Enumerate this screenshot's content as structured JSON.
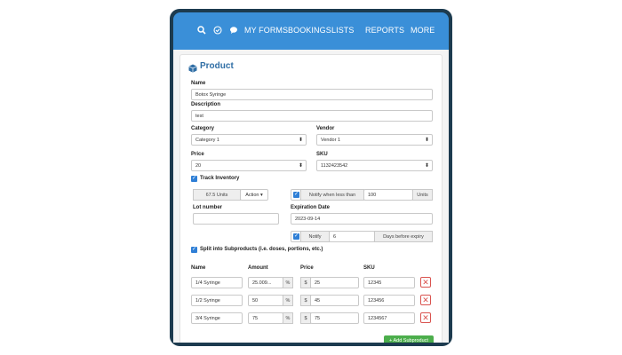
{
  "nav": {
    "icons": [
      "search-icon",
      "check-circle-icon",
      "chat-bubble-icon"
    ],
    "items": [
      "MY FORMS",
      "BOOKINGS",
      "LISTS",
      "REPORTS",
      "MORE"
    ]
  },
  "form": {
    "title": "Product",
    "name_label": "Name",
    "name_value": "Botox Syringe",
    "description_label": "Description",
    "description_value": "test",
    "category_label": "Category",
    "category_value": "Category 1",
    "vendor_label": "Vendor",
    "vendor_value": "Vendor 1",
    "price_label": "Price",
    "price_value": "20",
    "sku_label": "SKU",
    "sku_value": "1132423542",
    "track_inventory_label": "Track Inventory",
    "units_value": "67.5 Units",
    "action_label": "Action",
    "notify_less_label": "Notify when less than",
    "notify_less_value": "100",
    "units_suffix": "Units",
    "lot_label": "Lot number",
    "lot_value": "",
    "expiration_label": "Expiration Date",
    "expiration_value": "2023-09-14",
    "notify_label": "Notify",
    "notify_days_value": "6",
    "days_before_label": "Days before expiry",
    "split_label": "Split into Subproducts (i.e. doses, portions, etc.)"
  },
  "subproducts": {
    "headers": [
      "Name",
      "Amount",
      "Price",
      "SKU"
    ],
    "rows": [
      {
        "name": "1/4 Syringe",
        "amount": "25.009...",
        "price": "25",
        "sku": "12345"
      },
      {
        "name": "1/2 Syringe",
        "amount": "50",
        "price": "45",
        "sku": "123456"
      },
      {
        "name": "3/4 Syringe",
        "amount": "75",
        "price": "75",
        "sku": "1234567"
      }
    ],
    "percent": "%",
    "currency": "$",
    "add_label": "+ Add Subproduct"
  },
  "colors": {
    "nav_bar": "#3a8fd8",
    "device_frame": "#1d3b4f",
    "title": "#2f6ea5",
    "checkbox": "#2f7fd6",
    "delete": "#d9534f",
    "add_button": "#4cae4c"
  }
}
